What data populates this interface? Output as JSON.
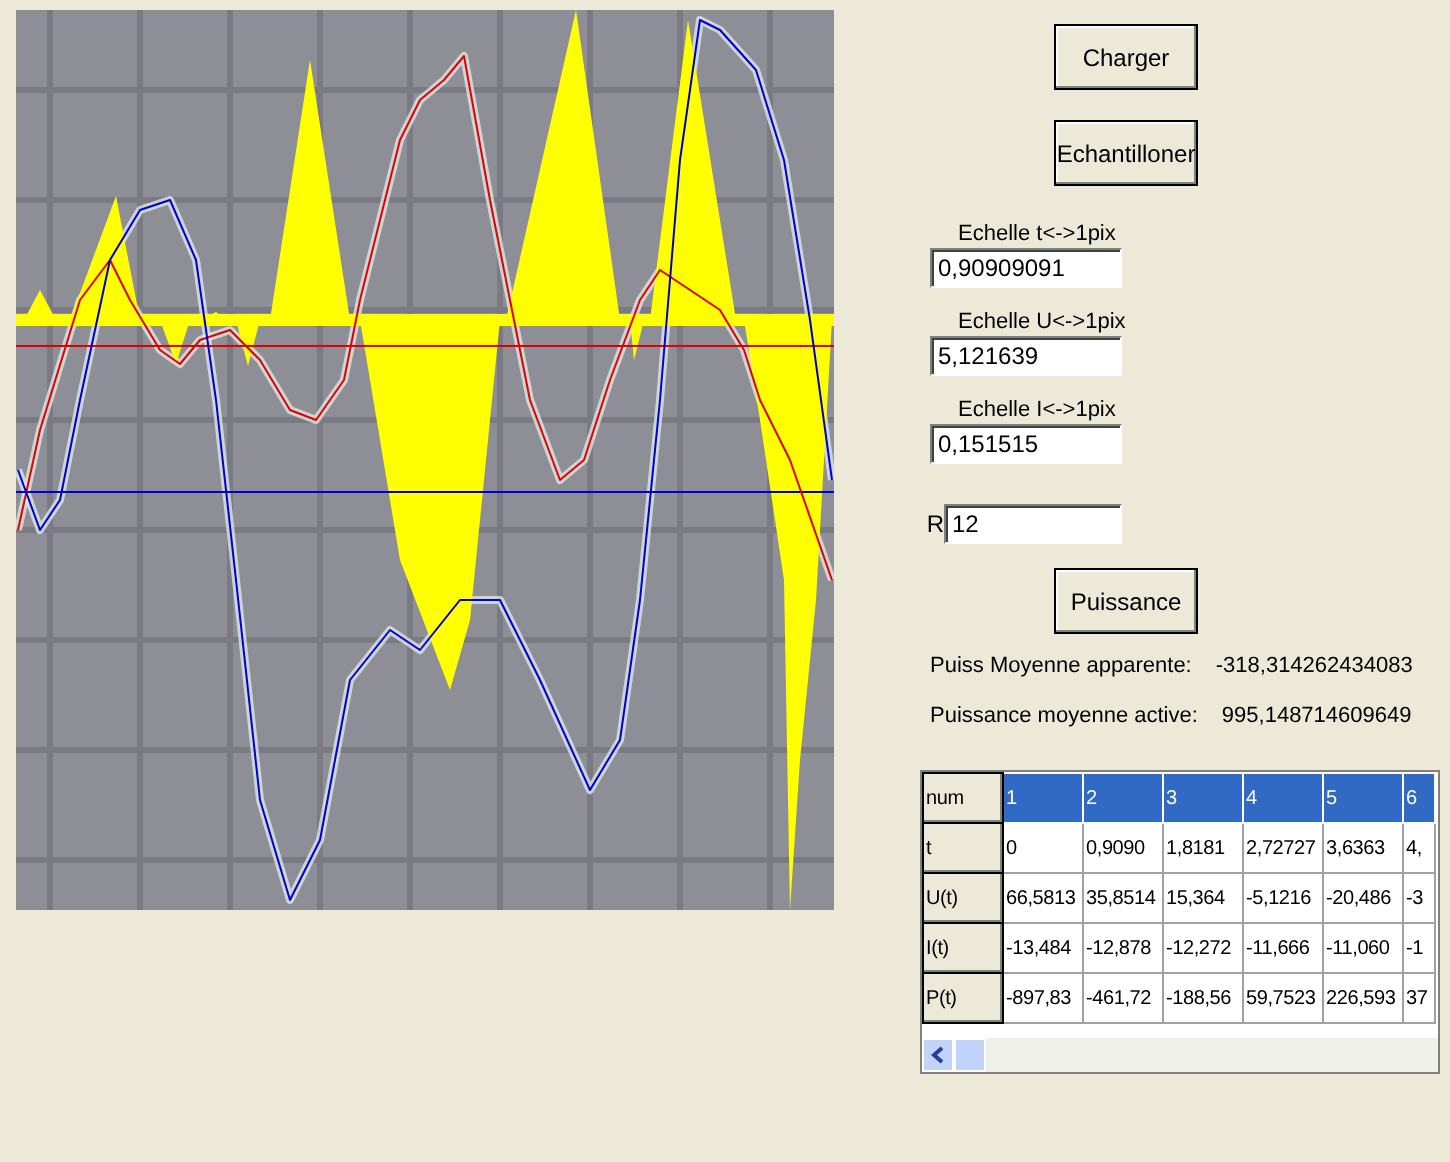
{
  "buttons": {
    "load": "Charger",
    "sample": "Echantilloner",
    "power": "Puissance"
  },
  "scales": [
    {
      "label": "Echelle t<->1pix",
      "value": "0,90909091"
    },
    {
      "label": "Echelle U<->1pix",
      "value": "5,121639"
    },
    {
      "label": "Echelle I<->1pix",
      "value": "0,151515"
    }
  ],
  "resistance": {
    "label": "R",
    "value": "12"
  },
  "results": [
    {
      "label": "Puiss Moyenne apparente:",
      "value": "-318,314262434083"
    },
    {
      "label": "Puissance moyenne active:",
      "value": "995,148714609649"
    }
  ],
  "table": {
    "header": [
      "num",
      "1",
      "2",
      "3",
      "4",
      "5",
      "6"
    ],
    "rows": [
      [
        "t",
        "0",
        "0,9090",
        "1,8181",
        "2,72727",
        "3,6363",
        "4,"
      ],
      [
        "U(t)",
        "66,5813",
        "35,8514",
        "15,364",
        "-5,1216",
        "-20,486",
        "-3"
      ],
      [
        "I(t)",
        "-13,484",
        "-12,878",
        "-12,272",
        "-11,666",
        "-11,060",
        "-1"
      ],
      [
        "P(t)",
        "-897,83",
        "-461,72",
        "-188,56",
        "59,7523",
        "226,593",
        "37"
      ]
    ]
  }
}
